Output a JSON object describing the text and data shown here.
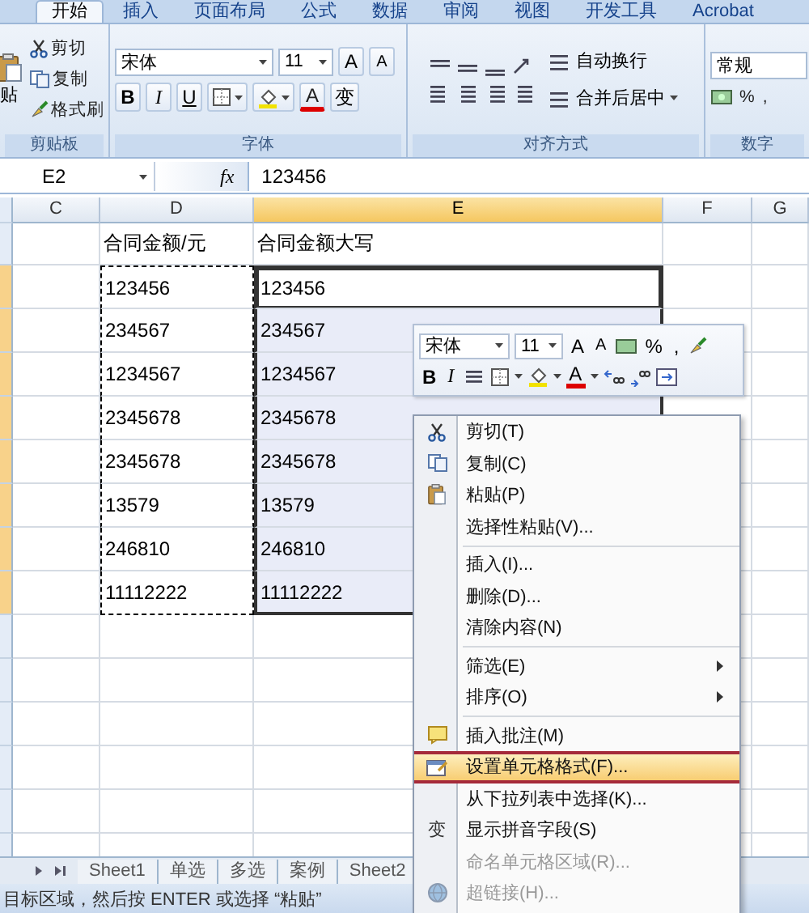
{
  "ribbon_tabs": [
    {
      "label": "开始",
      "selected": true
    },
    {
      "label": "插入",
      "selected": false
    },
    {
      "label": "页面布局",
      "selected": false
    },
    {
      "label": "公式",
      "selected": false
    },
    {
      "label": "数据",
      "selected": false
    },
    {
      "label": "审阅",
      "selected": false
    },
    {
      "label": "视图",
      "selected": false
    },
    {
      "label": "开发工具",
      "selected": false
    },
    {
      "label": "Acrobat",
      "selected": false
    }
  ],
  "clipboard_group": {
    "label": "剪贴板",
    "paste": "贴",
    "commands": [
      "剪切",
      "复制",
      "格式刷"
    ]
  },
  "font_group": {
    "label": "字体",
    "font_name": "宋体",
    "font_size": "11",
    "grow_font": "A",
    "shrink_font": "A",
    "bold": "B",
    "italic": "I",
    "underline": "U",
    "font_color": "A",
    "phonetic": "变"
  },
  "alignment_group": {
    "label": "对齐方式",
    "wrap_text": "自动换行",
    "merge_center": "合并后居中"
  },
  "number_group": {
    "label": "数字",
    "format": "常规",
    "percent": "%",
    "comma": ","
  },
  "formula_bar": {
    "name_box": "E2",
    "function_label": "fx",
    "value": "123456"
  },
  "columns": [
    {
      "label": "C",
      "selected": false
    },
    {
      "label": "D",
      "selected": false
    },
    {
      "label": "E",
      "selected": true
    },
    {
      "label": "F",
      "selected": false
    },
    {
      "label": "G",
      "selected": false
    }
  ],
  "rows": [
    {
      "d": "合同金额/元",
      "e": "合同金额大写",
      "selected": false,
      "active": false,
      "copied": false
    },
    {
      "d": "123456",
      "e": "123456",
      "selected": true,
      "active": true,
      "copied": true
    },
    {
      "d": "234567",
      "e": "234567",
      "selected": true,
      "active": false,
      "copied": true
    },
    {
      "d": "1234567",
      "e": "1234567",
      "selected": true,
      "active": false,
      "copied": true
    },
    {
      "d": "2345678",
      "e": "2345678",
      "selected": true,
      "active": false,
      "copied": true
    },
    {
      "d": "2345678",
      "e": "2345678",
      "selected": true,
      "active": false,
      "copied": true
    },
    {
      "d": "13579",
      "e": "13579",
      "selected": true,
      "active": false,
      "copied": true
    },
    {
      "d": "246810",
      "e": "246810",
      "selected": true,
      "active": false,
      "copied": true
    },
    {
      "d": "11112222",
      "e": "11112222",
      "selected": true,
      "active": false,
      "copied": true
    }
  ],
  "mini_toolbar": {
    "font_name": "宋体",
    "font_size": "11",
    "grow_font": "A",
    "shrink_font": "A",
    "percent": "%",
    "comma": ",",
    "bold": "B",
    "italic": "I",
    "font_color": "A"
  },
  "context_menu": [
    {
      "kind": "command",
      "label": "剪切(T)",
      "highlighted": false,
      "disabled": false
    },
    {
      "kind": "command",
      "label": "复制(C)",
      "highlighted": false,
      "disabled": false
    },
    {
      "kind": "command",
      "label": "粘贴(P)",
      "highlighted": false,
      "disabled": false
    },
    {
      "kind": "command",
      "label": "选择性粘贴(V)...",
      "highlighted": false,
      "disabled": false
    },
    {
      "kind": "separator"
    },
    {
      "kind": "command",
      "label": "插入(I)...",
      "highlighted": false,
      "disabled": false
    },
    {
      "kind": "command",
      "label": "删除(D)...",
      "highlighted": false,
      "disabled": false
    },
    {
      "kind": "command",
      "label": "清除内容(N)",
      "highlighted": false,
      "disabled": false
    },
    {
      "kind": "separator"
    },
    {
      "kind": "submenu",
      "label": "筛选(E)",
      "highlighted": false,
      "disabled": false
    },
    {
      "kind": "submenu",
      "label": "排序(O)",
      "highlighted": false,
      "disabled": false
    },
    {
      "kind": "separator"
    },
    {
      "kind": "command",
      "label": "插入批注(M)",
      "highlighted": false,
      "disabled": false
    },
    {
      "kind": "command",
      "label": "设置单元格格式(F)...",
      "highlighted": true,
      "disabled": false
    },
    {
      "kind": "command",
      "label": "从下拉列表中选择(K)...",
      "highlighted": false,
      "disabled": false
    },
    {
      "kind": "command",
      "label": "显示拼音字段(S)",
      "icon_text": "变",
      "highlighted": false,
      "disabled": false
    },
    {
      "kind": "command",
      "label": "命名单元格区域(R)...",
      "highlighted": false,
      "disabled": true
    },
    {
      "kind": "command",
      "label": "超链接(H)...",
      "highlighted": false,
      "disabled": true
    }
  ],
  "sheet_tabs": [
    {
      "label": "Sheet1",
      "selected": false
    },
    {
      "label": "单选",
      "selected": false
    },
    {
      "label": "多选",
      "selected": false
    },
    {
      "label": "案例",
      "selected": false
    },
    {
      "label": "Sheet2",
      "selected": false
    }
  ],
  "status_bar": "目标区域，然后按 ENTER 或选择 “粘贴”"
}
